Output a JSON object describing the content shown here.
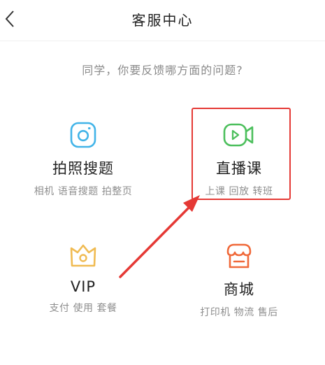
{
  "header": {
    "title": "客服中心",
    "back_icon": "chevron-left-icon"
  },
  "prompt": "同学，你要反馈哪方面的问题?",
  "categories": [
    {
      "label": "拍照搜题",
      "sub": "相机 语音搜题 拍整页",
      "icon": "camera-icon",
      "color": "#42b4e8"
    },
    {
      "label": "直播课",
      "sub": "上课 回放 转班",
      "icon": "video-camera-icon",
      "color": "#4cbf5c"
    },
    {
      "label": "VIP",
      "sub": "支付 使用 套餐",
      "icon": "crown-icon",
      "color": "#f0bb52"
    },
    {
      "label": "商城",
      "sub": "打印机 物流 售后",
      "icon": "shop-icon",
      "color": "#f0693a"
    }
  ],
  "annotation": {
    "color": "#e53935"
  }
}
